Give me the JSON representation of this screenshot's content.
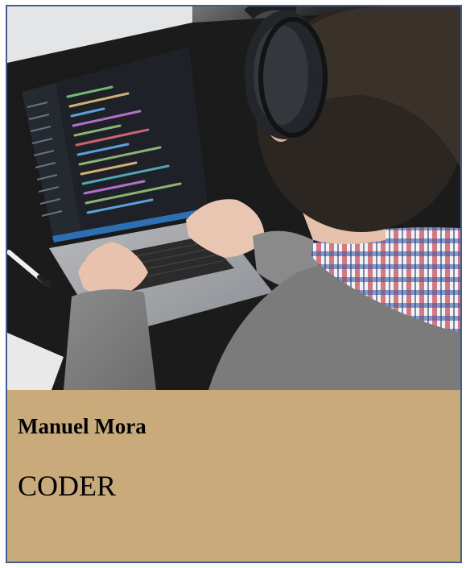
{
  "card": {
    "name": "Manuel Mora",
    "role": "CODER",
    "caption_background": "#c9aa7b",
    "border_color": "#3f5f93"
  },
  "photo": {
    "subject": "person-wearing-headphones-coding-on-laptop"
  }
}
